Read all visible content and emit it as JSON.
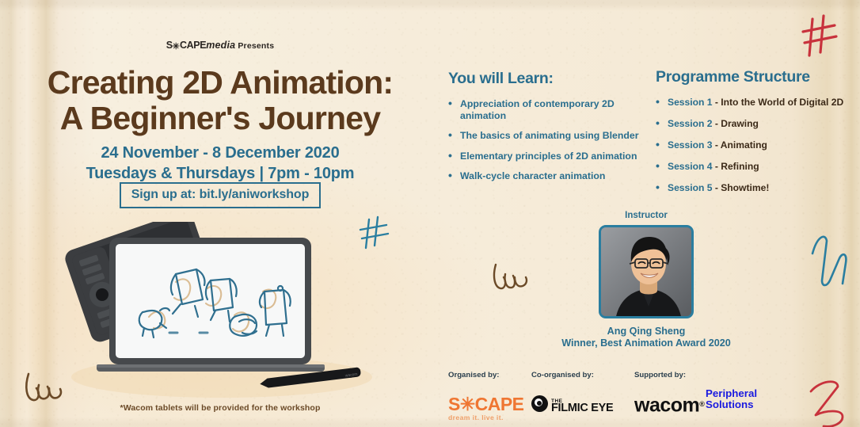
{
  "poster": {
    "brand": {
      "scape": "S",
      "star": "✳",
      "cape": "CAPE",
      "media": "media",
      "presents": "Presents"
    },
    "title_line1": "Creating 2D Animation:",
    "title_line2": "A Beginner's Journey",
    "dates_line1": "24 November - 8 December 2020",
    "dates_line2": "Tuesdays & Thursdays | 7pm - 10pm",
    "signup_label": "Sign up at: bit.ly/aniworkshop",
    "disclaimer": "*Wacom tablets will be provided for the workshop"
  },
  "learn": {
    "heading": "You will Learn:",
    "items": [
      "Appreciation of contemporary 2D animation",
      "The basics of animating using Blender",
      "Elementary principles of 2D animation",
      "Walk-cycle character animation"
    ]
  },
  "programme": {
    "heading": "Programme Structure",
    "items": [
      {
        "session": "Session 1",
        "sep": " - ",
        "topic": "Into the World of Digital 2D"
      },
      {
        "session": "Session 2",
        "sep": " - ",
        "topic": "Drawing"
      },
      {
        "session": "Session 3",
        "sep": " - ",
        "topic": "Animating"
      },
      {
        "session": "Session 4",
        "sep": " - ",
        "topic": "Refining"
      },
      {
        "session": "Session 5",
        "sep": " - ",
        "topic": "Showtime!"
      }
    ]
  },
  "instructor": {
    "label": "Instructor",
    "name": "Ang Qing Sheng",
    "credential": "Winner, Best Animation Award 2020"
  },
  "partners": [
    {
      "label": "Organised by:",
      "logo": "scape-logo",
      "name": "S✳CAPE",
      "tagline": "dream it. live it."
    },
    {
      "label": "Co-organised by:",
      "logo": "filmic-eye-logo",
      "the": "THE",
      "name": "FILMIC EYE"
    },
    {
      "label": "Supported by:",
      "logo": "wacom-logo",
      "name": "wacom",
      "mark": "®"
    },
    {
      "label": "",
      "logo": "peripheral-solutions-logo",
      "line1": "Peripheral",
      "line2": "Solutions"
    }
  ],
  "colors": {
    "paper": "#f6ecda",
    "title_brown": "#5b3a1d",
    "accent_blue": "#2a6e8e",
    "body_dark": "#3c2a18",
    "scape_orange": "#ef7632",
    "periph_blue": "#1a1ae0",
    "doodle_red": "#c8323c",
    "doodle_blue": "#2a7ea0",
    "doodle_brown": "#6b4a28"
  },
  "illustration": {
    "name": "laptop-and-graphics-tablet-illustration",
    "screen_content": "animation-keyframe-sketches",
    "stylus": "wacom-stylus-pen"
  }
}
